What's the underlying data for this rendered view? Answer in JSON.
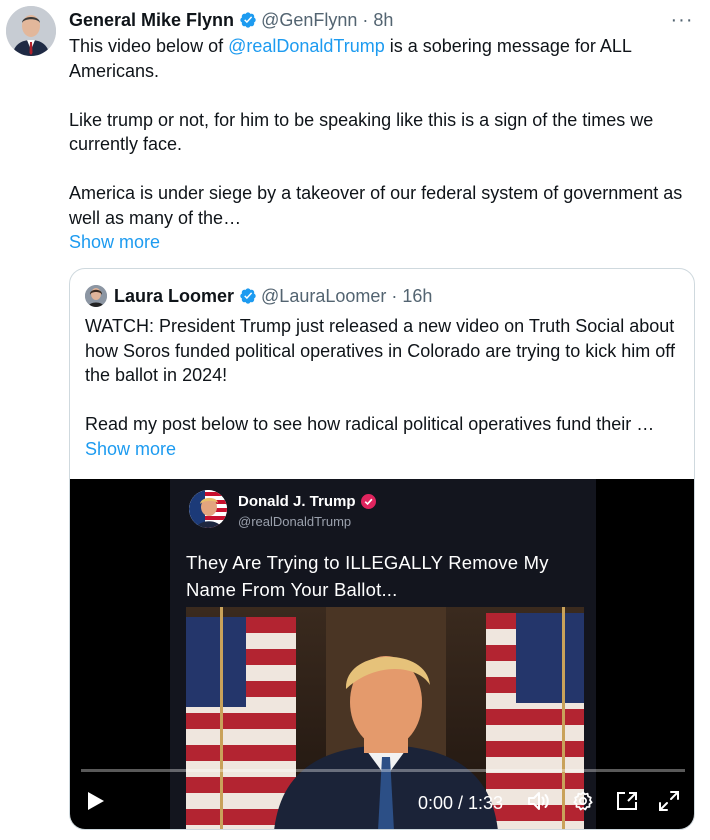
{
  "tweet": {
    "author_name": "General Mike Flynn",
    "author_handle": "@GenFlynn",
    "separator": "·",
    "time": "8h",
    "more_label": "···",
    "text_line1_pre": "This video below of ",
    "mention": "@realDonaldTrump",
    "text_line1_post": " is a sobering message for ALL Americans.",
    "paragraph2": "Like trump or not, for him to be speaking like this is a sign of the times we currently face.",
    "paragraph3": "America is under siege by a takeover of our federal system of government as well as many of the…",
    "show_more": "Show more"
  },
  "quote": {
    "author_name": "Laura Loomer",
    "author_handle": "@LauraLoomer",
    "separator": "·",
    "time": "16h",
    "paragraph1": "WATCH: President Trump just released a new video on Truth Social about how Soros funded political operatives in Colorado are trying to kick him off the ballot in 2024!",
    "paragraph2": "Read my post below to see how radical political operatives fund their …",
    "show_more": "Show more"
  },
  "video": {
    "ts_name": "Donald J. Trump",
    "ts_handle": "@realDonaldTrump",
    "ts_text": "They Are Trying to ILLEGALLY Remove My Name From Your Ballot...",
    "time_display": "0:00 / 1:33",
    "progress": 0
  },
  "colors": {
    "accent": "#1d9bf0",
    "text": "#0f1419",
    "muted": "#536471",
    "border": "#cfd9de",
    "truth_badge": "#e0245e"
  },
  "icons": [
    "verified-icon",
    "more-icon",
    "play-icon",
    "volume-icon",
    "settings-icon",
    "pip-icon",
    "fullscreen-icon"
  ]
}
